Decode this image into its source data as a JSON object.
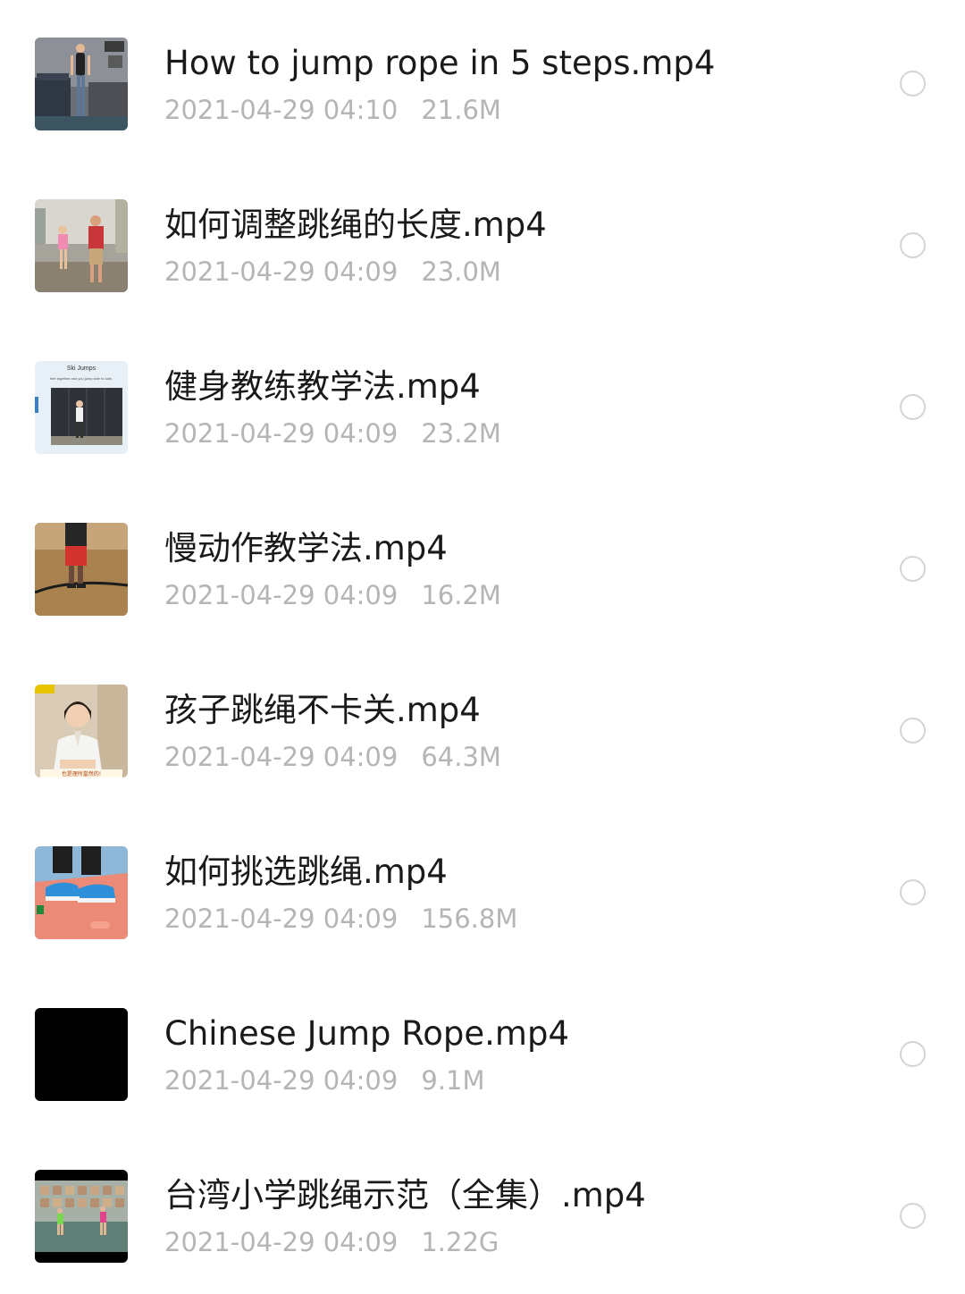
{
  "files": [
    {
      "name": "How to jump rope in 5 steps.mp4",
      "date": "2021-04-29 04:10",
      "size": "21.6M",
      "thumbnail_icon": "video-thumbnail-icon"
    },
    {
      "name": "如何调整跳绳的长度.mp4",
      "date": "2021-04-29 04:09",
      "size": "23.0M",
      "thumbnail_icon": "video-thumbnail-icon"
    },
    {
      "name": "健身教练教学法.mp4",
      "date": "2021-04-29 04:09",
      "size": "23.2M",
      "thumbnail_icon": "video-thumbnail-icon",
      "thumbnail_text": [
        "Ski Jumps",
        "feet together and you jump side to side."
      ]
    },
    {
      "name": "慢动作教学法.mp4",
      "date": "2021-04-29 04:09",
      "size": "16.2M",
      "thumbnail_icon": "video-thumbnail-icon"
    },
    {
      "name": "孩子跳绳不卡关.mp4",
      "date": "2021-04-29 04:09",
      "size": "64.3M",
      "thumbnail_icon": "video-thumbnail-icon",
      "thumbnail_text": [
        "也是理所當然的!"
      ]
    },
    {
      "name": "如何挑选跳绳.mp4",
      "date": "2021-04-29 04:09",
      "size": "156.8M",
      "thumbnail_icon": "video-thumbnail-icon"
    },
    {
      "name": "Chinese Jump Rope.mp4",
      "date": "2021-04-29 04:09",
      "size": "9.1M",
      "thumbnail_icon": "video-thumbnail-icon"
    },
    {
      "name": "台湾小学跳绳示范（全集）.mp4",
      "date": "2021-04-29 04:09",
      "size": "1.22G",
      "thumbnail_icon": "video-thumbnail-icon"
    }
  ],
  "colors": {
    "name_text": "#1a1a1a",
    "meta_text": "#b5b5b5",
    "select_circle_border": "#d4d4d4",
    "background": "#ffffff"
  }
}
